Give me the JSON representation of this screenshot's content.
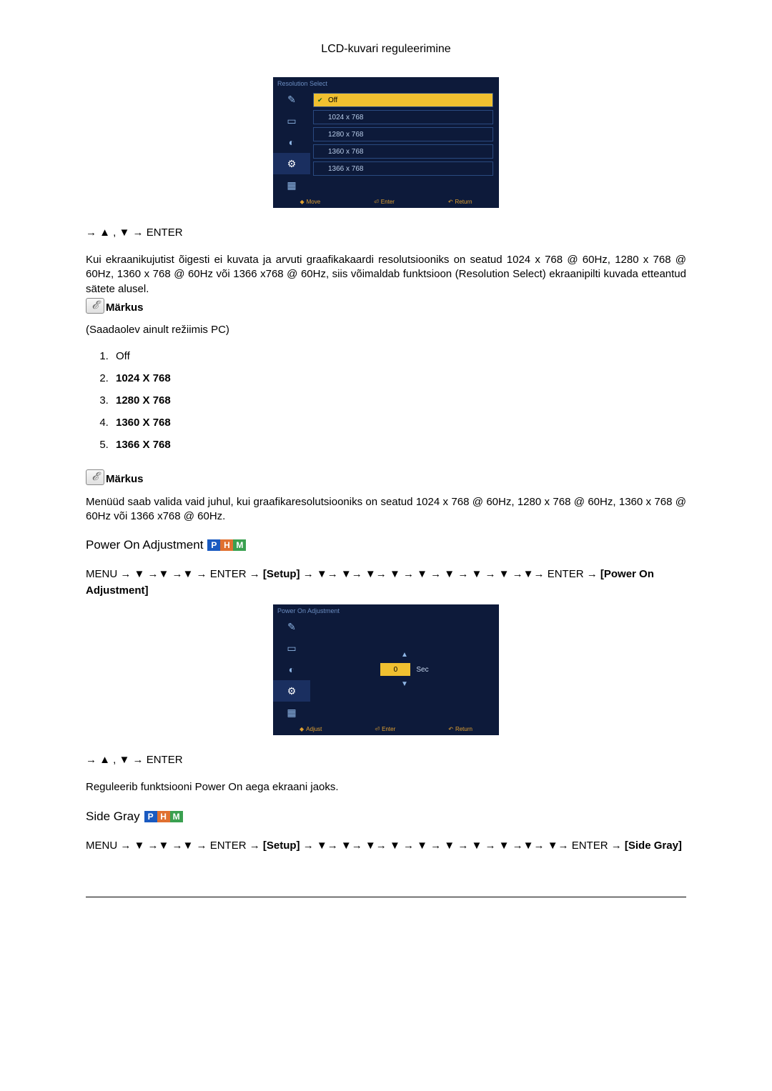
{
  "header": {
    "title": "LCD-kuvari reguleerimine"
  },
  "osd1": {
    "title": "Resolution Select",
    "options": [
      "Off",
      "1024 x 768",
      "1280 x 768",
      "1360 x 768",
      "1366 x 768"
    ],
    "footer": {
      "move": "Move",
      "enter": "Enter",
      "return": "Return"
    }
  },
  "nav1": "→ ▲ , ▼ → ENTER",
  "para1": "Kui ekraanikujutist õigesti ei kuvata ja arvuti graafikakaardi resolutsiooniks on seatud 1024 x 768 @ 60Hz, 1280 x 768 @ 60Hz, 1360 x 768 @ 60Hz või 1366 x768 @ 60Hz, siis võimaldab funktsioon (Resolution Select) ekraanipilti kuvada etteantud sätete alusel.",
  "note_label": "Märkus",
  "note1_text": "(Saadaolev ainult režiimis PC)",
  "res_list": [
    "Off",
    "1024 X 768",
    "1280 X 768",
    "1360 X 768",
    "1366 X 768"
  ],
  "para2": "Menüüd saab valida vaid juhul, kui graafikaresolutsiooniks on seatud 1024 x 768 @ 60Hz, 1280 x 768 @ 60Hz, 1360 x 768 @ 60Hz või 1366 x768 @ 60Hz.",
  "section2": {
    "title": "Power On Adjustment"
  },
  "menu2": {
    "prefix": "MENU → ▼ →▼ →▼ → ENTER → ",
    "setup": "[Setup]",
    "mid": " → ▼→ ▼→ ▼→ ▼ → ▼ → ▼ → ▼ → ▼ →▼→ ENTER → ",
    "target": "[Power On Adjustment]"
  },
  "osd2": {
    "title": "Power On Adjustment",
    "value": "0",
    "unit": "Sec",
    "footer": {
      "adjust": "Adjust",
      "enter": "Enter",
      "return": "Return"
    }
  },
  "nav2": "→ ▲ , ▼ → ENTER",
  "para3": "Reguleerib funktsiooni Power On aega ekraani jaoks.",
  "section3": {
    "title": "Side Gray"
  },
  "menu3": {
    "prefix": "MENU → ▼ →▼ →▼ → ENTER → ",
    "setup": "[Setup]",
    "mid": " → ▼→ ▼→ ▼→ ▼ → ▼ → ▼ → ▼ → ▼ →▼→ ▼→ ENTER → ",
    "target": "[Side Gray]"
  }
}
